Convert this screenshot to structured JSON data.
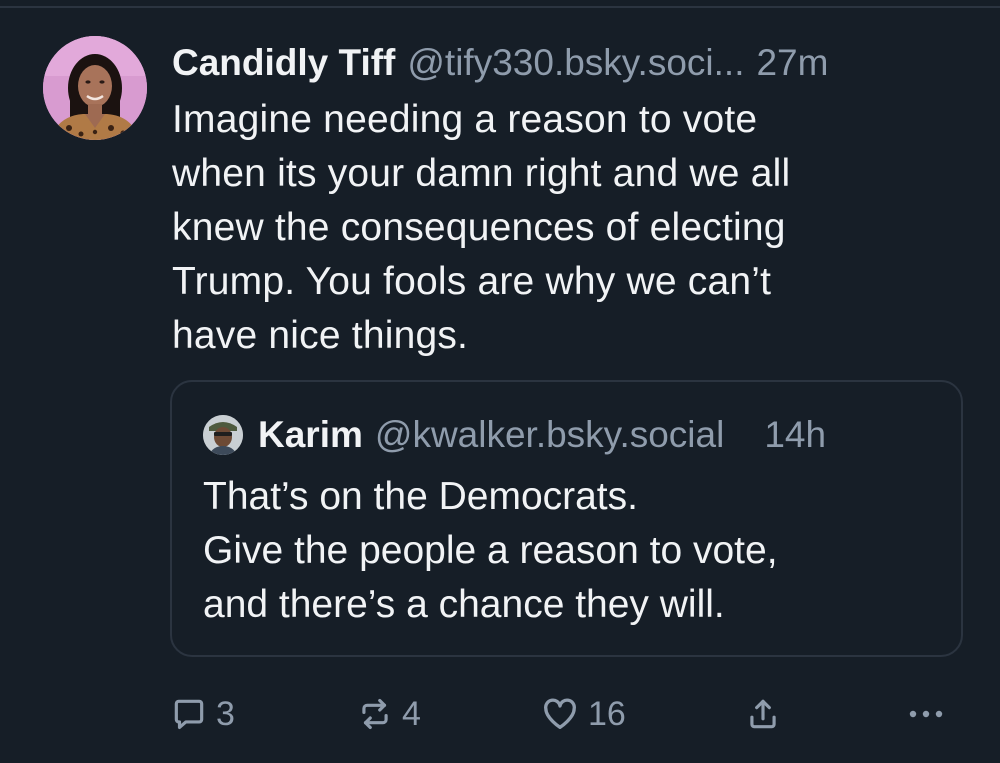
{
  "post": {
    "author": {
      "display_name": "Candidly Tiff",
      "handle": "@tify330.bsky.soci...",
      "timestamp": "27m"
    },
    "text": "Imagine needing a reason to vote\nwhen its your damn right and we all\nknew the consequences of electing\nTrump. You fools are why we can’t\nhave nice things."
  },
  "quote": {
    "author": {
      "display_name": "Karim",
      "handle": "@kwalker.bsky.social",
      "timestamp": "14h"
    },
    "text": "That’s on the Democrats.\nGive the people a reason to vote,\nand there’s a chance they will."
  },
  "actions": {
    "reply_count": "3",
    "repost_count": "4",
    "like_count": "16"
  },
  "icons": {
    "reply": "reply-icon",
    "repost": "repost-icon",
    "like": "heart-icon",
    "share": "share-icon",
    "more": "more-icon"
  },
  "colors": {
    "background": "#161e27",
    "text": "#f1f3f5",
    "muted": "#8f9cac",
    "border": "#2b3440"
  }
}
